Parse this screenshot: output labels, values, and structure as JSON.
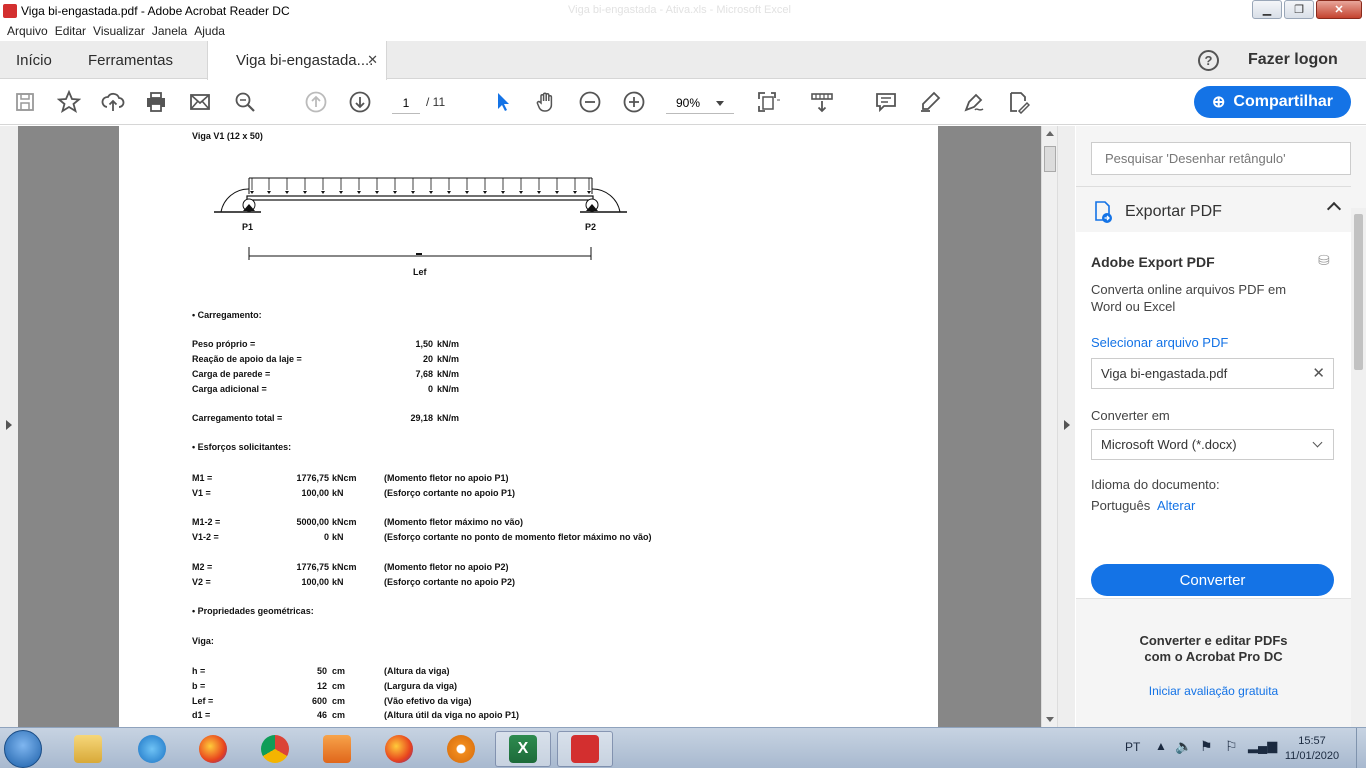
{
  "window": {
    "title": "Viga bi-engastada.pdf - Adobe Acrobat Reader DC",
    "ghost_title": "Viga bi-engastada - Ativa.xls - Microsoft Excel"
  },
  "menu": [
    "Arquivo",
    "Editar",
    "Visualizar",
    "Janela",
    "Ajuda"
  ],
  "tabs": {
    "home": "Início",
    "tools": "Ferramentas",
    "doc": "Viga bi-engastada....",
    "login": "Fazer logon"
  },
  "toolbar": {
    "page_current": "1",
    "page_total": "/ 11",
    "zoom": "90%",
    "share_label": "Compartilhar",
    "icons": [
      "save-icon",
      "star-icon",
      "upload-icon",
      "print-icon",
      "mail-icon",
      "search-icon",
      "page-up-icon",
      "page-down-icon",
      "cursor-icon",
      "hand-icon",
      "zoom-out-icon",
      "zoom-in-icon",
      "fit-page-icon",
      "scroll-mode-icon",
      "comment-icon",
      "highlight-icon",
      "sign-icon",
      "edit-icon"
    ]
  },
  "document": {
    "heading": "Viga V1 (12 x 50)",
    "support_left": "P1",
    "support_right": "P2",
    "span_label": "Lef",
    "section_loads": "• Carregamento:",
    "loads": [
      {
        "label": "Peso próprio =",
        "value": "1,50",
        "unit": "kN/m"
      },
      {
        "label": "Reação de apoio da laje =",
        "value": "20",
        "unit": "kN/m"
      },
      {
        "label": "Carga de parede =",
        "value": "7,68",
        "unit": "kN/m"
      },
      {
        "label": "Carga adicional =",
        "value": "0",
        "unit": "kN/m"
      }
    ],
    "total": {
      "label": "Carregamento total =",
      "value": "29,18",
      "unit": "kN/m"
    },
    "section_forces": "• Esforços solicitantes:",
    "forces": [
      {
        "label": "M1 =",
        "value": "1776,75",
        "unit": "kNcm",
        "desc": "(Momento fletor no apoio P1)"
      },
      {
        "label": "V1 =",
        "value": "100,00",
        "unit": "kN",
        "desc": "(Esforço cortante no apoio P1)"
      },
      {
        "label": "M1-2 =",
        "value": "5000,00",
        "unit": "kNcm",
        "desc": "(Momento fletor máximo no vão)"
      },
      {
        "label": "V1-2 =",
        "value": "0",
        "unit": "kN",
        "desc": "(Esforço cortante no ponto de momento fletor máximo no vão)"
      },
      {
        "label": "M2 =",
        "value": "1776,75",
        "unit": "kNcm",
        "desc": "(Momento fletor no apoio P2)"
      },
      {
        "label": "V2 =",
        "value": "100,00",
        "unit": "kN",
        "desc": "(Esforço cortante no apoio P2)"
      }
    ],
    "section_geom": "• Propriedades geométricas:",
    "beam_label": "Viga:",
    "geom": [
      {
        "label": "h =",
        "value": "50",
        "unit": "cm",
        "desc": "(Altura da viga)"
      },
      {
        "label": "b =",
        "value": "12",
        "unit": "cm",
        "desc": "(Largura da viga)"
      },
      {
        "label": "Lef =",
        "value": "600",
        "unit": "cm",
        "desc": "(Vão efetivo da viga)"
      },
      {
        "label": "d1 =",
        "value": "46",
        "unit": "cm",
        "desc": "(Altura útil da viga no apoio P1)"
      }
    ]
  },
  "panel": {
    "search_placeholder": "Pesquisar 'Desenhar retângulo'",
    "export_title": "Exportar PDF",
    "adobe_export": "Adobe Export PDF",
    "desc_line1": "Converta online arquivos PDF em",
    "desc_line2": "Word ou Excel",
    "select_file": "Selecionar arquivo PDF",
    "file_name": "Viga bi-engastada.pdf",
    "convert_to_label": "Converter em",
    "format": "Microsoft Word (*.docx)",
    "doc_lang_label": "Idioma do documento:",
    "doc_lang": "Português",
    "change_link": "Alterar",
    "convert_btn": "Converter",
    "promo_line1": "Converter e editar PDFs",
    "promo_line2": "com o Acrobat Pro DC",
    "trial_link": "Iniciar avaliação gratuita"
  },
  "taskbar": {
    "apps": [
      "explorer-icon",
      "ie-icon",
      "firefox-icon",
      "chrome-icon",
      "media-player-icon",
      "firefox-icon",
      "gear-app-icon",
      "excel-icon",
      "acrobat-icon"
    ],
    "lang": "PT",
    "time": "15:57",
    "date": "11/01/2020"
  },
  "colors": {
    "accent": "#1473e6",
    "doc_bg": "#878787"
  }
}
